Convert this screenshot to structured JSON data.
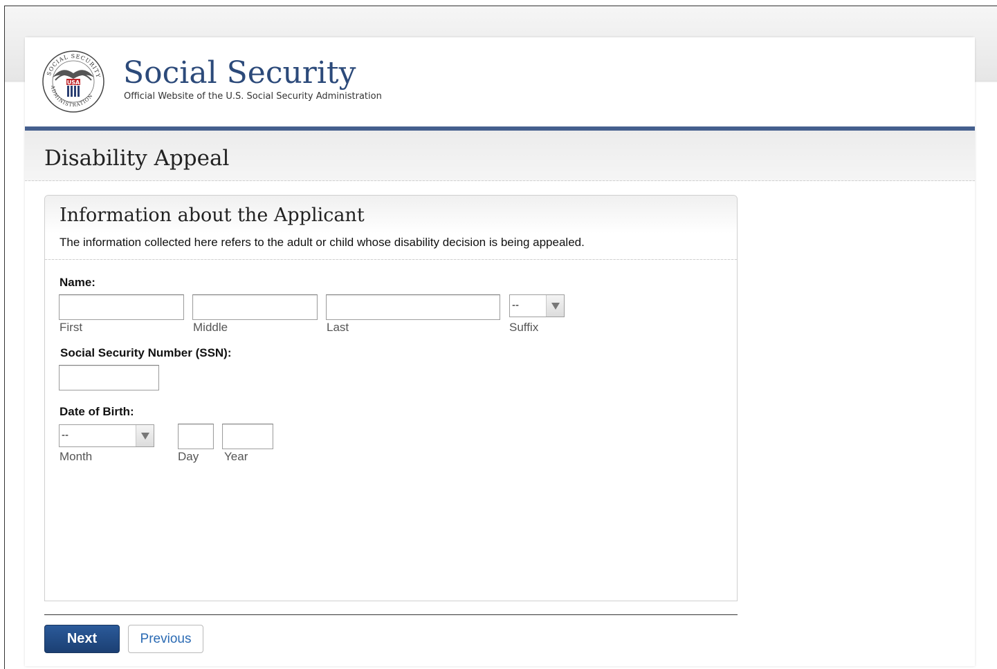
{
  "header": {
    "brand_title": "Social Security",
    "brand_subtitle": "Official Website of the U.S. Social Security Administration",
    "seal_text": "SOCIAL SECURITY ADMINISTRATION USA"
  },
  "page": {
    "title": "Disability Appeal"
  },
  "panel": {
    "title": "Information about the Applicant",
    "description": "The information collected here refers to the adult or child whose disability decision is being appealed."
  },
  "name_section": {
    "label": "Name:",
    "first_label": "First",
    "first_value": "",
    "middle_label": "Middle",
    "middle_value": "",
    "last_label": "Last",
    "last_value": "",
    "suffix_label": "Suffix",
    "suffix_value": "--"
  },
  "ssn_section": {
    "label": "Social Security Number (SSN):",
    "value": ""
  },
  "dob_section": {
    "label": "Date of Birth:",
    "month_label": "Month",
    "month_value": "--",
    "day_label": "Day",
    "day_value": "",
    "year_label": "Year",
    "year_value": ""
  },
  "buttons": {
    "next_label": "Next",
    "previous_label": "Previous"
  },
  "colors": {
    "brand_blue": "#2c4a7a",
    "header_rule": "#455f8e",
    "next_button": "#1f4a85",
    "link_blue": "#2a6ab3"
  }
}
